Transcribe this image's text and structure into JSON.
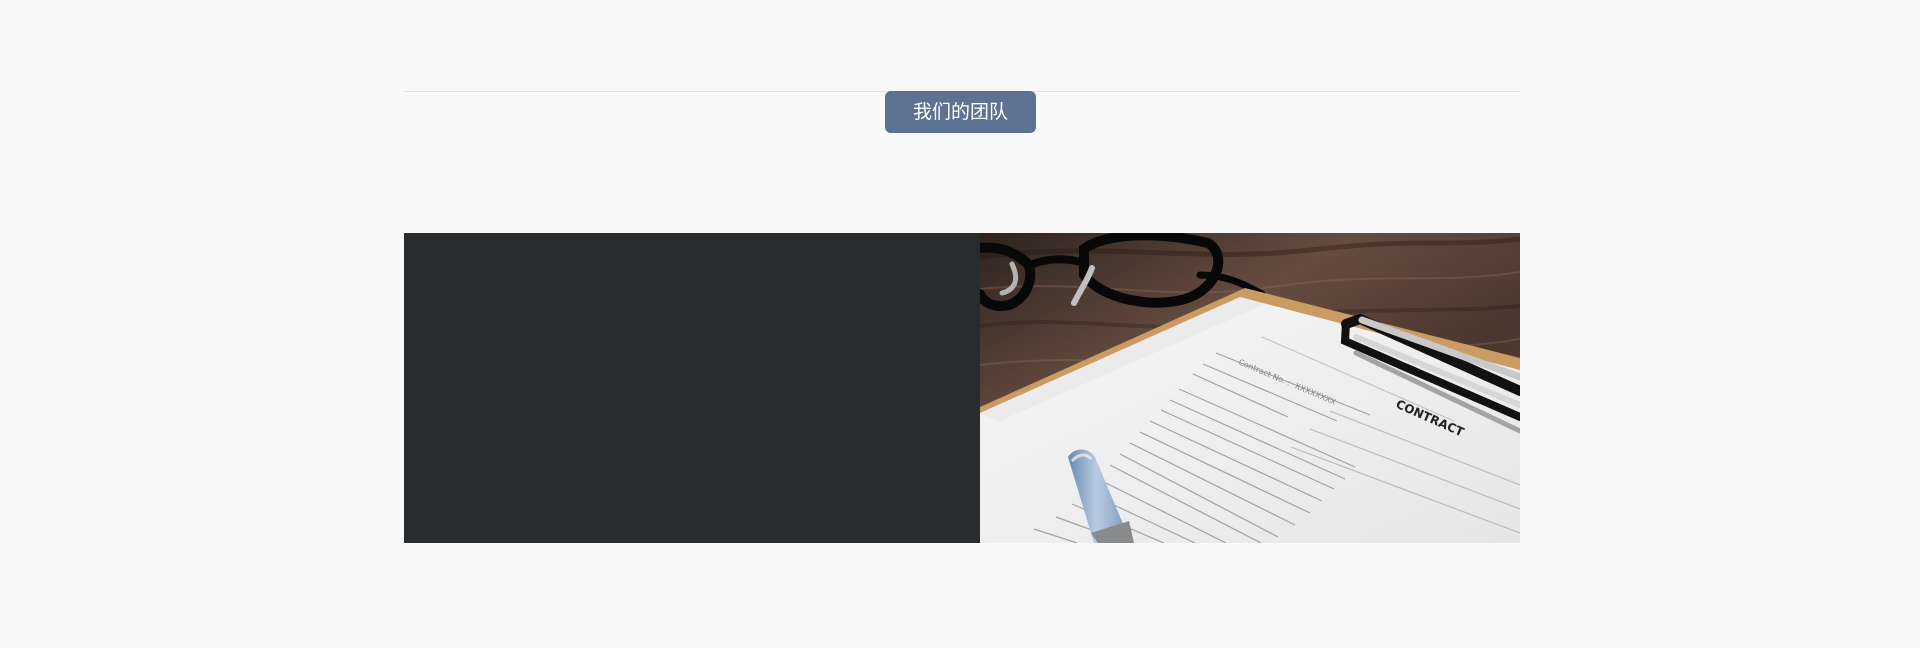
{
  "section": {
    "title": "我们的团队"
  },
  "team": {
    "image_description": "",
    "contract_label": "CONTRACT",
    "contract_number_prefix": "Contract No. :",
    "contract_number": "XXXXXXXX"
  },
  "colors": {
    "page_background": "#f9f9f9",
    "divider": "#e4e4e4",
    "title_badge": "#5d7193",
    "dark_block": "#282c2f",
    "wood": "#4f3b30"
  }
}
